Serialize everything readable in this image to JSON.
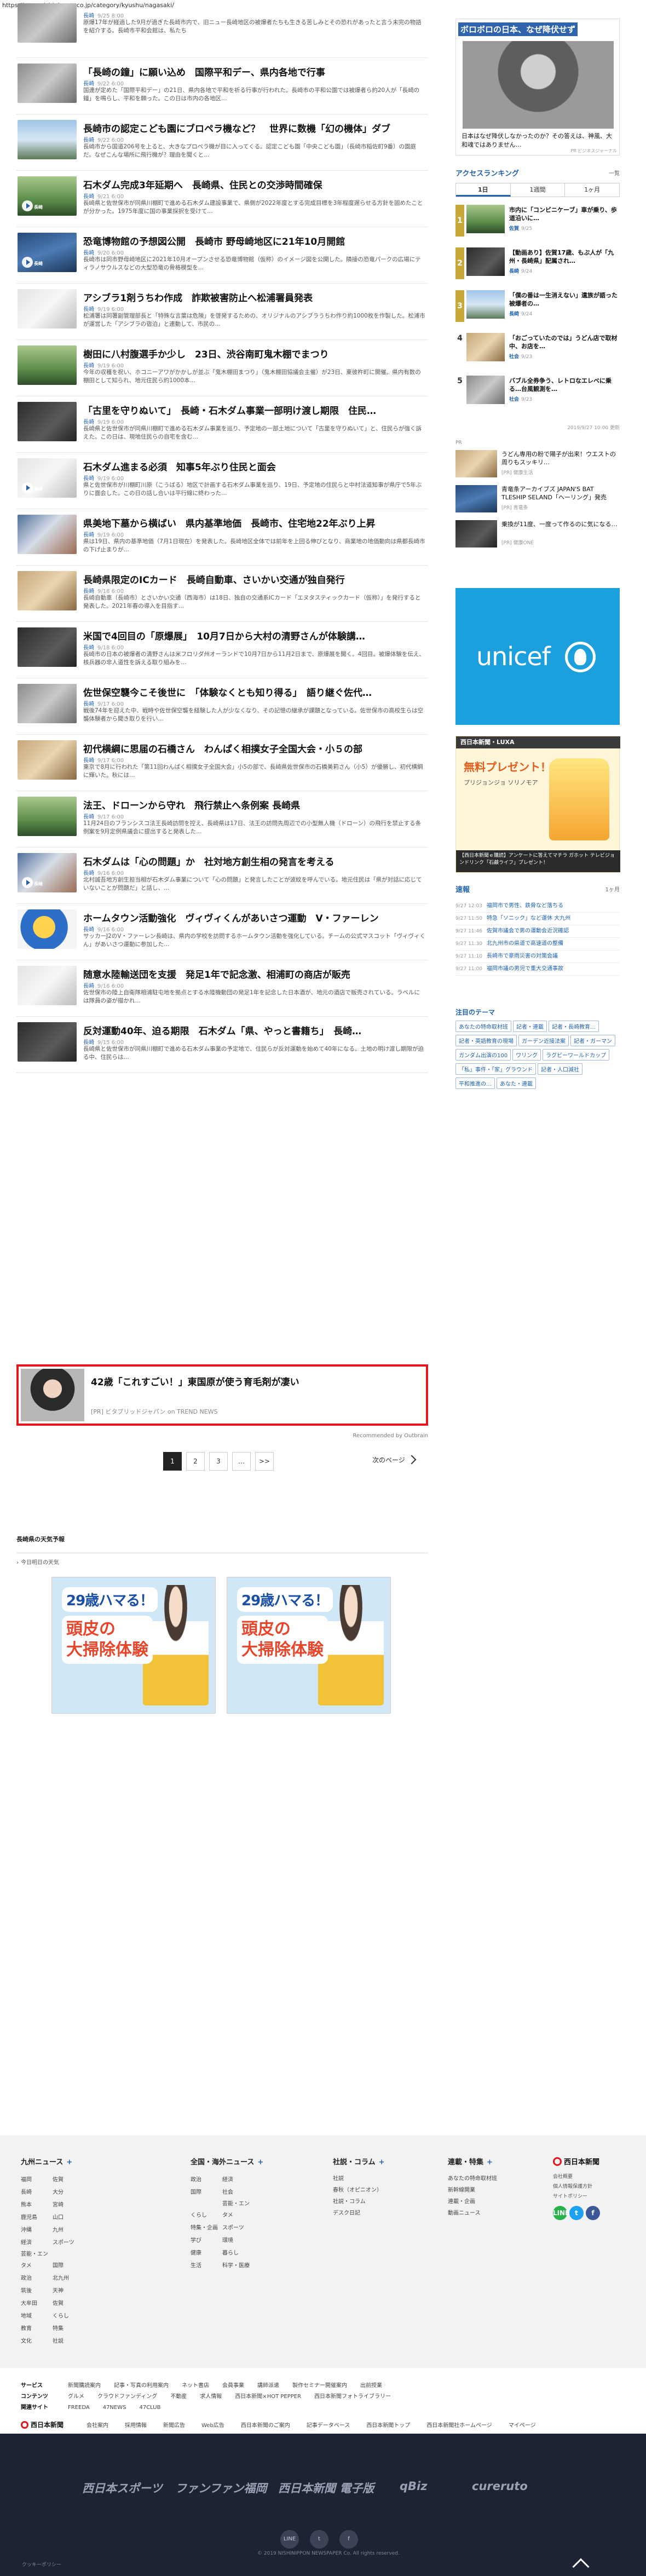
{
  "page": {
    "url": "https://www.nishinippon.co.jp/category/kyushu/nagasaki/"
  },
  "articles": [
    {
      "title": "",
      "tag": "長崎",
      "time": "9/25 8:00",
      "desc": "原爆17年が経過した9月が過ぎた長崎市内で、旧ニュー長崎地区の被爆者たちも生きる苦しみとその恐れがあったと言う未完の物語を紹介する。長崎市平和会館は、私たち",
      "thumb": "p-gray",
      "video": false
    },
    {
      "title": "「長崎の鐘」に願い込め　国際平和デー、県内各地で行事",
      "tag": "長崎",
      "time": "9/22 6:00",
      "desc": "国連が定めた「国際平和デー」の21日、県内各地で平和を祈る行事が行われた。長崎市の平和公園では被爆者ら約20人が「長崎の鐘」を鳴らし、平和を願った。この日は市内の各地区…",
      "thumb": "p-gray",
      "video": false
    },
    {
      "title": "長崎市の認定こども園にブロペラ機など？　世界に数機「幻の機体」ダブ",
      "tag": "長崎",
      "time": "9/22 6:00",
      "desc": "長崎市から国道206号を上ると、大きなプロペラ機が目に入ってくる。認定こども園「中央こども園」（長崎市稲佐町9番）の園庭だ。なぜこんな場所に飛行機が？理由を聞くと…",
      "thumb": "p-sky",
      "video": false
    },
    {
      "title": "石木ダム完成3年延期へ　長崎県、住民との交渉時間確保",
      "tag": "長崎",
      "time": "9/21 6:00",
      "desc": "長崎県と佐世保市が同県川棚町で進める石木ダム建設事業で、県側が2022年度とする完成目標を3年程度遅らせる方針を固めたことが分かった。1975年度に国の事業採択を受けて…",
      "thumb": "p-green",
      "video": true
    },
    {
      "title": "恐竜博物館の予想図公開　長崎市 野母崎地区に21年10月開館",
      "tag": "長崎",
      "time": "9/20 6:00",
      "desc": "長崎市は同市野母崎地区に2021年10月オープンさせる恐竜博物館（仮称）のイメージ図を公開した。隣接の恐竜パークの広場にティラノサウルスなどの大型恐竜の骨格模型を…",
      "thumb": "p-blue",
      "video": true
    },
    {
      "title": "アシブラ1剤うちわ作成　詐欺被害防止へ松浦署員発表",
      "tag": "長崎",
      "time": "9/19 6:00",
      "desc": "松浦署は同署副管理部長と「特殊な言葉は危険」を啓発するための、オリジナルのアシブラうちわ作り約1000枚を作製した。松浦市が運営した「アシブラの宿泊」と連動して、市民の…",
      "thumb": "p-white",
      "video": false
    },
    {
      "title": "樹田に八村腹選手か少し　23日、渋谷南町鬼木棚でまつり",
      "tag": "長崎",
      "time": "9/19 6:00",
      "desc": "今年の収穫を祝い、ホコニーアワがかかしが並ぶ「鬼木棚田まつり」（鬼木棚田協議会主催）が23日、東彼杵町に開催。県内有数の棚田として知られ、地元住民ら約1000本…",
      "thumb": "p-green",
      "video": false
    },
    {
      "title": "「古里を守りぬいて」　長崎・石木ダム事業一部明け渡し期限　住民…",
      "tag": "長崎",
      "time": "9/19 6:00",
      "desc": "長崎県と佐世保市が同県川棚町で進める石木ダム事業を巡り、予定地の一部土地について「古里を守りぬいて」と、住民らが強く訴えた。この日は、現地住民らの自宅を含む…",
      "thumb": "p-dark",
      "video": false
    },
    {
      "title": "石木ダム進まる必須　知事5年ぶり住民と面会",
      "tag": "長崎",
      "time": "9/19 6:00",
      "desc": "県と佐世保市が川棚町川原（こうばる）地区で計画する石木ダム事業を巡り、19日、予定地の住民らと中村法道知事が県庁で5年ぶりに面会した。この日の話し合いは平行線に終わった…",
      "thumb": "p-white",
      "video": true
    },
    {
      "title": "県美地下墓から横ばい　県内基準地価　長崎市、住宅地22年ぶり上昇",
      "tag": "長崎",
      "time": "9/19 6:00",
      "desc": "県は19日、県内の基準地価（7月1日現在）を発表した。長崎地区全体では前年を上回る伸びとなり、商業地の地価動向は県都長崎市の下げ止まりが…",
      "thumb": "p-mix",
      "video": false
    },
    {
      "title": "長崎県限定のICカード　長崎自動車、さいかい交通が独自発行",
      "tag": "長崎",
      "time": "9/18 6:00",
      "desc": "長崎自動車（長崎市）とさいかい交通（西海市）は18日、独自の交通系ICカード「エヌタスティックカード（仮称）」を発行すると発表した。2021年春の導入を目指す…",
      "thumb": "p-warm",
      "video": false
    },
    {
      "title": "米国で4回目の「原爆展」　10月7日から大村の清野さんが体験講…",
      "tag": "長崎",
      "time": "9/18 6:00",
      "desc": "長崎市の日本の被爆者の清野さんは米フロリダ州オーランドで10月7日から11月2日まで、原爆展を開く。4回目。被爆体験を伝え、核兵器の非人道性を訴える取り組みを…",
      "thumb": "p-dark",
      "video": false
    },
    {
      "title": "佐世保空襲今こそ後世に　「体験なくとも知り得る」　語り継ぐ佐代…",
      "tag": "長崎",
      "time": "9/17 6:00",
      "desc": "戦後74年を迎えた中、戦時や佐世保空襲を経験した人が少なくなり、その記憶の継承が課題となっている。佐世保市の高校生らは空襲体験者から聞き取りを行い…",
      "thumb": "p-gray",
      "video": false
    },
    {
      "title": "初代横綱に思届の石橋さん　わんぱく相撲女子全国大会・小５の部",
      "tag": "長崎",
      "time": "9/17 6:00",
      "desc": "東京で8月に行われた「第11回わんぱく相撲女子全国大会」小5の部で、長崎県佐世保市の石橋美莉さん（小5）が優勝し、初代横綱に輝いた。秋には…",
      "thumb": "p-warm",
      "video": false
    },
    {
      "title": "法王、ドローンから守れ　飛行禁止へ条例案 長崎県",
      "tag": "長崎",
      "time": "9/17 6:00",
      "desc": "11月24日のフランシスコ法王長崎訪問を控え、長崎県は17日、法王の訪問先周辺での小型無人機（ドローン）の飛行を禁止する条例案を9月定例県議会に提出すると発表した…",
      "thumb": "p-green",
      "video": false
    },
    {
      "title": "石木ダムは「心の問題」か　社対地方創生相の発言を考える",
      "tag": "長崎",
      "time": "9/16 6:00",
      "desc": "北村誠吾地方創生担当相が石木ダム事業について「心の問題」と発言したことが波紋を呼んでいる。地元住民は「県が対話に応じていないことが問題だ」と話し、…",
      "thumb": "p-mix",
      "video": true
    },
    {
      "title": "ホームタウン活動強化　ヴィヴィくんがあいさつ運動　V・ファーレン",
      "tag": "長崎",
      "time": "9/16 6:00",
      "desc": "サッカーJ2のV・ファーレン長崎は、県内の学校を訪問するホームタウン活動を強化している。チームの公式マスコット「ヴィヴィくん」があいさつ運動に参加した…",
      "thumb": "p-mascot",
      "video": false
    },
    {
      "title": "随意水陸輸送団を支援　発足1年で記念激、相浦町の商店が販売",
      "tag": "長崎",
      "time": "9/16 6:00",
      "desc": "佐世保市の陸上自衛隊相浦駐屯地を拠点とする水陸機動団の発足1年を記念した日本酒が、地元の酒店で販売されている。ラベルには隊員の姿が描かれ…",
      "thumb": "p-white",
      "video": false
    },
    {
      "title": "反対運動40年、迫る期限　石木ダム「県、やっと書籍ち」　長崎…",
      "tag": "長崎",
      "time": "9/15 6:00",
      "desc": "長崎県と佐世保市が同県川棚町で進める石木ダム事業の予定地で、住民らが反対運動を始めて40年になる。土地の明け渡し期限が迫る中、住民らは…",
      "thumb": "p-dark",
      "video": false
    }
  ],
  "promo": {
    "title": "42歳「これすごい！」東国原が使う育毛剤が凄い",
    "source": "[PR] ビタブリッドジャパン on TREND NEWS",
    "recommended": "Recommended by Outbrain"
  },
  "pager": {
    "p1": "1",
    "p2": "2",
    "p3": "3",
    "ellipsis": "…",
    "last": ">>",
    "next": "次のページ"
  },
  "weather": {
    "heading": "長崎県の天気予報",
    "sub": "今日明日の天気"
  },
  "banner": {
    "line1": "29歳ハマる！",
    "line2": "頭皮の\n大掃除体験"
  },
  "sidebar": {
    "ad": {
      "title": "ボロボロの日本、なぜ降伏せず",
      "text": "日本はなぜ降伏しなかったのか？その答えは、神風、大和魂ではありません…",
      "source": "PR ビジネスジャーナル"
    },
    "ranking_head": "アクセスランキング",
    "ranking_more": "一覧",
    "tabs": [
      "1日",
      "1週間",
      "1ヶ月"
    ],
    "ranking": [
      {
        "num": "1",
        "text": "市内に「コンビニケーブ」車が乗り、歩道沿いに…",
        "cat": "佐賀",
        "time": "9/25",
        "img": "p-green"
      },
      {
        "num": "2",
        "text": "【動画あり】佐賀17歳、もぶ人が「九州・長崎県」配属され…",
        "cat": "長崎",
        "time": "9/24",
        "img": "p-dark"
      },
      {
        "num": "3",
        "text": "「僕の番は一生消えない」遺族が語った被爆者の…",
        "cat": "長崎",
        "time": "9/24",
        "img": "p-sky"
      },
      {
        "num": "4",
        "text": "「おごっていたのでは」うどん店で取材中、お店を…",
        "cat": "社会",
        "time": "9/23",
        "img": "p-warm"
      },
      {
        "num": "5",
        "text": "バブル全券争う、レトロなエレベに乗る…台風観測を…",
        "cat": "社会",
        "time": "9/23",
        "img": "p-gray"
      }
    ],
    "ranking_time": "2019/9/27 10:00 更新",
    "pr_label": "PR",
    "pr": [
      {
        "text": "うどん専用の粉で陽子が出来！ウエストの周りもスッキリ…",
        "src": "[PR] 健康生活",
        "img": "p-warm"
      },
      {
        "text": "青竜条アーカイブズ JAPAN'S BAT TLESHIP SELAND「ヘーリング」発売",
        "src": "[PR] 青竜条",
        "img": "p-blue"
      },
      {
        "text": "乗換が11度、一度って作るのに気になる…",
        "src": "[PR] 健康ONE",
        "img": "p-dark"
      }
    ],
    "unicef": "unicef",
    "luxa": {
      "head": "西日本新聞・LUXA",
      "big": "無料プレゼント！",
      "sub": "プリジョンジョ ソリノモア",
      "foot": "【西日本新聞ｅ購読】アンケートに答えてマチラ ガホット テレビジョンドリンク「石鹸ライフ」プレゼント！"
    },
    "hot_head": "速報",
    "hot_more": "1ヶ月",
    "hot": [
      {
        "t": "9/27 12:03",
        "x": "福岡市で男性、鉄骨など落ちる"
      },
      {
        "t": "9/27 11:50",
        "x": "特急「ソニック」など運休 大九州"
      },
      {
        "t": "9/27 11:46",
        "x": "佐賀市議会で男の運動会近況確認"
      },
      {
        "t": "9/27 11:30",
        "x": "北九州市の県道で高速道の整備"
      },
      {
        "t": "9/27 11:10",
        "x": "長崎市で豪雨災害の対策会議"
      },
      {
        "t": "9/27 11:00",
        "x": "福岡市議の男児で重大交通事故"
      }
    ],
    "theme_head": "注目のテーマ",
    "themes": [
      "あなたの特命取材班",
      "記者・連載",
      "記者・長崎教育…",
      "記者・英語教育の現場",
      "ガーデン近接法案",
      "記者・ガーマン",
      "ガンダム出演の100",
      "ワリング",
      "ラグビーワールドカップ",
      "「私」事件・「家」グラウンド",
      "記者・人口減社",
      "平和推進の…",
      "あなた・連載"
    ]
  },
  "footer": {
    "col1_head": "九州ニュース",
    "col1": [
      "福岡",
      "佐賀",
      "長崎",
      "大分",
      "熊本",
      "宮崎",
      "鹿児島",
      "山口",
      "沖縄",
      "九州",
      "経済",
      "スポーツ",
      "芸能・エンタメ",
      "国際",
      "政治",
      "北九州",
      "筑後",
      "天神",
      "大牟田",
      "佐賀",
      "地域",
      "くらし",
      "教育",
      "特集",
      "文化",
      "社説"
    ],
    "col2_head": "全国・海外ニュース",
    "col2": [
      "政治",
      "経済",
      "国際",
      "社会",
      "くらし",
      "芸能・エンタメ",
      "特集・企画",
      "スポーツ",
      "学び",
      "環境",
      "健康",
      "暮らし",
      "生活",
      "科学・医療"
    ],
    "col3_head": "社説・コラム",
    "col3": [
      "社説",
      "春秋（オピニオン）",
      "社説・コラム",
      "デスク日記"
    ],
    "col4_head": "連載・特集",
    "col4": [
      "あなたの特命取材班",
      "新幹線開業",
      "連載・企画",
      "動画ニュース"
    ],
    "brand": "西日本新聞",
    "brand_links": [
      "会社概要",
      "個人情報保護方針",
      "サイトポリシー"
    ],
    "sns": [
      "LINE",
      "t",
      "f"
    ],
    "services_label": "サービス",
    "services": [
      "新聞購読案内",
      "記事・写真の利用案内",
      "ネット書店",
      "会員事業",
      "講師派遣",
      "製作セミナー開催案内",
      "出前授業"
    ],
    "contents_label": "コンテンツ",
    "contents": [
      "グルメ",
      "クラウドファンディング",
      "不動産",
      "求人情報",
      "西日本新聞×HOT PEPPER",
      "西日本新聞フォトライブラリー"
    ],
    "related_label": "関連サイト",
    "related": [
      "FREEDA",
      "47NEWS",
      "47CLUB"
    ],
    "corp": "西日本新聞",
    "corp_links": [
      "会社案内",
      "採用情報",
      "新聞広告",
      "Web広告",
      "西日本新聞のご案内",
      "記事データベース",
      "西日本新聞トップ",
      "西日本新聞社ホームページ",
      "マイページ"
    ],
    "partners": [
      "西日本スポーツ",
      "ファンファン福岡",
      "西日本新聞 電子版",
      "qBiz",
      "cureruto"
    ],
    "rounds": [
      "LINE",
      "t",
      "f"
    ],
    "cookie": "クッキーポリシー",
    "copyright": "© 2019 NISHINIPPON NEWSPAPER Co. All rights reserved."
  },
  "colors": {
    "accent": "#1f62b0",
    "promo_border": "#e3161e",
    "footer_dark": "#1d2333"
  }
}
